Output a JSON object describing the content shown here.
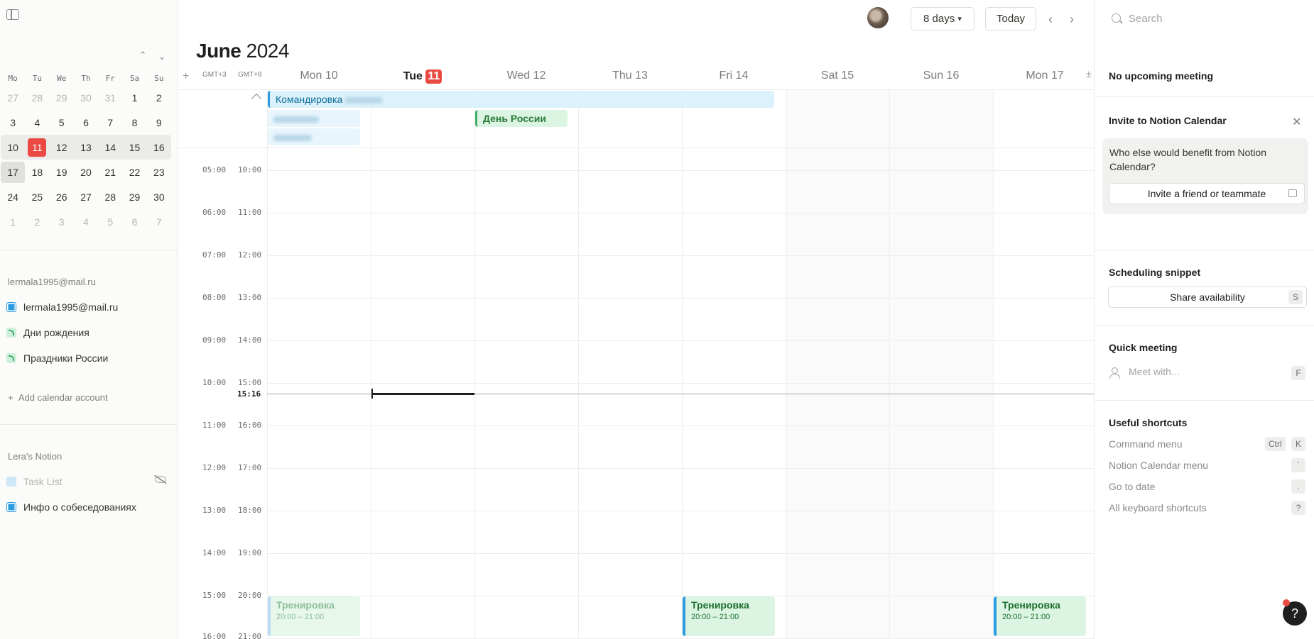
{
  "sidebar": {
    "mini_calendar": {
      "weekdays": [
        "Mo",
        "Tu",
        "We",
        "Th",
        "Fr",
        "Sa",
        "Su"
      ],
      "weeks": [
        [
          "27",
          "28",
          "29",
          "30",
          "31",
          "1",
          "2"
        ],
        [
          "3",
          "4",
          "5",
          "6",
          "7",
          "8",
          "9"
        ],
        [
          "10",
          "11",
          "12",
          "13",
          "14",
          "15",
          "16"
        ],
        [
          "17",
          "18",
          "19",
          "20",
          "21",
          "22",
          "23"
        ],
        [
          "24",
          "25",
          "26",
          "27",
          "28",
          "29",
          "30"
        ],
        [
          "1",
          "2",
          "3",
          "4",
          "5",
          "6",
          "7"
        ]
      ],
      "today": "11"
    },
    "account_section": "lermala1995@mail.ru",
    "calendars": [
      {
        "label": "lermala1995@mail.ru",
        "color": "#2c9ce0"
      },
      {
        "label": "Дни рождения",
        "color": "#3fae6a"
      },
      {
        "label": "Праздники России",
        "color": "#3fae6a"
      }
    ],
    "add_account": "Add calendar account",
    "notion_section": "Lera's Notion",
    "notion_items": [
      {
        "label": "Task List",
        "color": "#cfe7f6"
      },
      {
        "label": "Инфо о собеседованиях",
        "color": "#2c9ce0"
      }
    ]
  },
  "header": {
    "month": "June",
    "year": "2024",
    "view": "8 days",
    "today_btn": "Today",
    "tz_primary": "GMT+3",
    "tz_secondary": "GMT+8",
    "days": [
      {
        "label": "Mon 10"
      },
      {
        "label": "Tue",
        "num": "11"
      },
      {
        "label": "Wed 12"
      },
      {
        "label": "Thu 13"
      },
      {
        "label": "Fri 14"
      },
      {
        "label": "Sat 15"
      },
      {
        "label": "Sun 16"
      },
      {
        "label": "Mon 17"
      }
    ]
  },
  "allday": {
    "trip": "Командировка",
    "holiday": "День России"
  },
  "hours": [
    {
      "a": "05:00",
      "b": "10:00"
    },
    {
      "a": "06:00",
      "b": "11:00"
    },
    {
      "a": "07:00",
      "b": "12:00"
    },
    {
      "a": "08:00",
      "b": "13:00"
    },
    {
      "a": "09:00",
      "b": "14:00"
    },
    {
      "a": "10:00",
      "b": "15:00"
    },
    {
      "a": "11:00",
      "b": "16:00"
    },
    {
      "a": "12:00",
      "b": "17:00"
    },
    {
      "a": "13:00",
      "b": "18:00"
    },
    {
      "a": "14:00",
      "b": "19:00"
    },
    {
      "a": "15:00",
      "b": "20:00"
    },
    {
      "a": "16:00",
      "b": "21:00"
    }
  ],
  "now": "15:16",
  "events": {
    "title": "Тренировка",
    "time": "20:00 – 21:00"
  },
  "right_panel": {
    "search_placeholder": "Search",
    "no_meeting": "No upcoming meeting",
    "invite_title": "Invite to Notion Calendar",
    "invite_question": "Who else would benefit from Notion Calendar?",
    "invite_button": "Invite a friend or teammate",
    "snippet_title": "Scheduling snippet",
    "share_button": "Share availability",
    "share_key": "S",
    "quick_title": "Quick meeting",
    "meet_placeholder": "Meet with...",
    "meet_key": "F",
    "shortcuts_title": "Useful shortcuts",
    "shortcuts": [
      {
        "label": "Command menu",
        "keys": [
          "Ctrl",
          "K"
        ]
      },
      {
        "label": "Notion Calendar menu",
        "keys": [
          "`"
        ]
      },
      {
        "label": "Go to date",
        "keys": [
          "."
        ]
      },
      {
        "label": "All keyboard shortcuts",
        "keys": [
          "?"
        ]
      }
    ],
    "help": "?"
  }
}
